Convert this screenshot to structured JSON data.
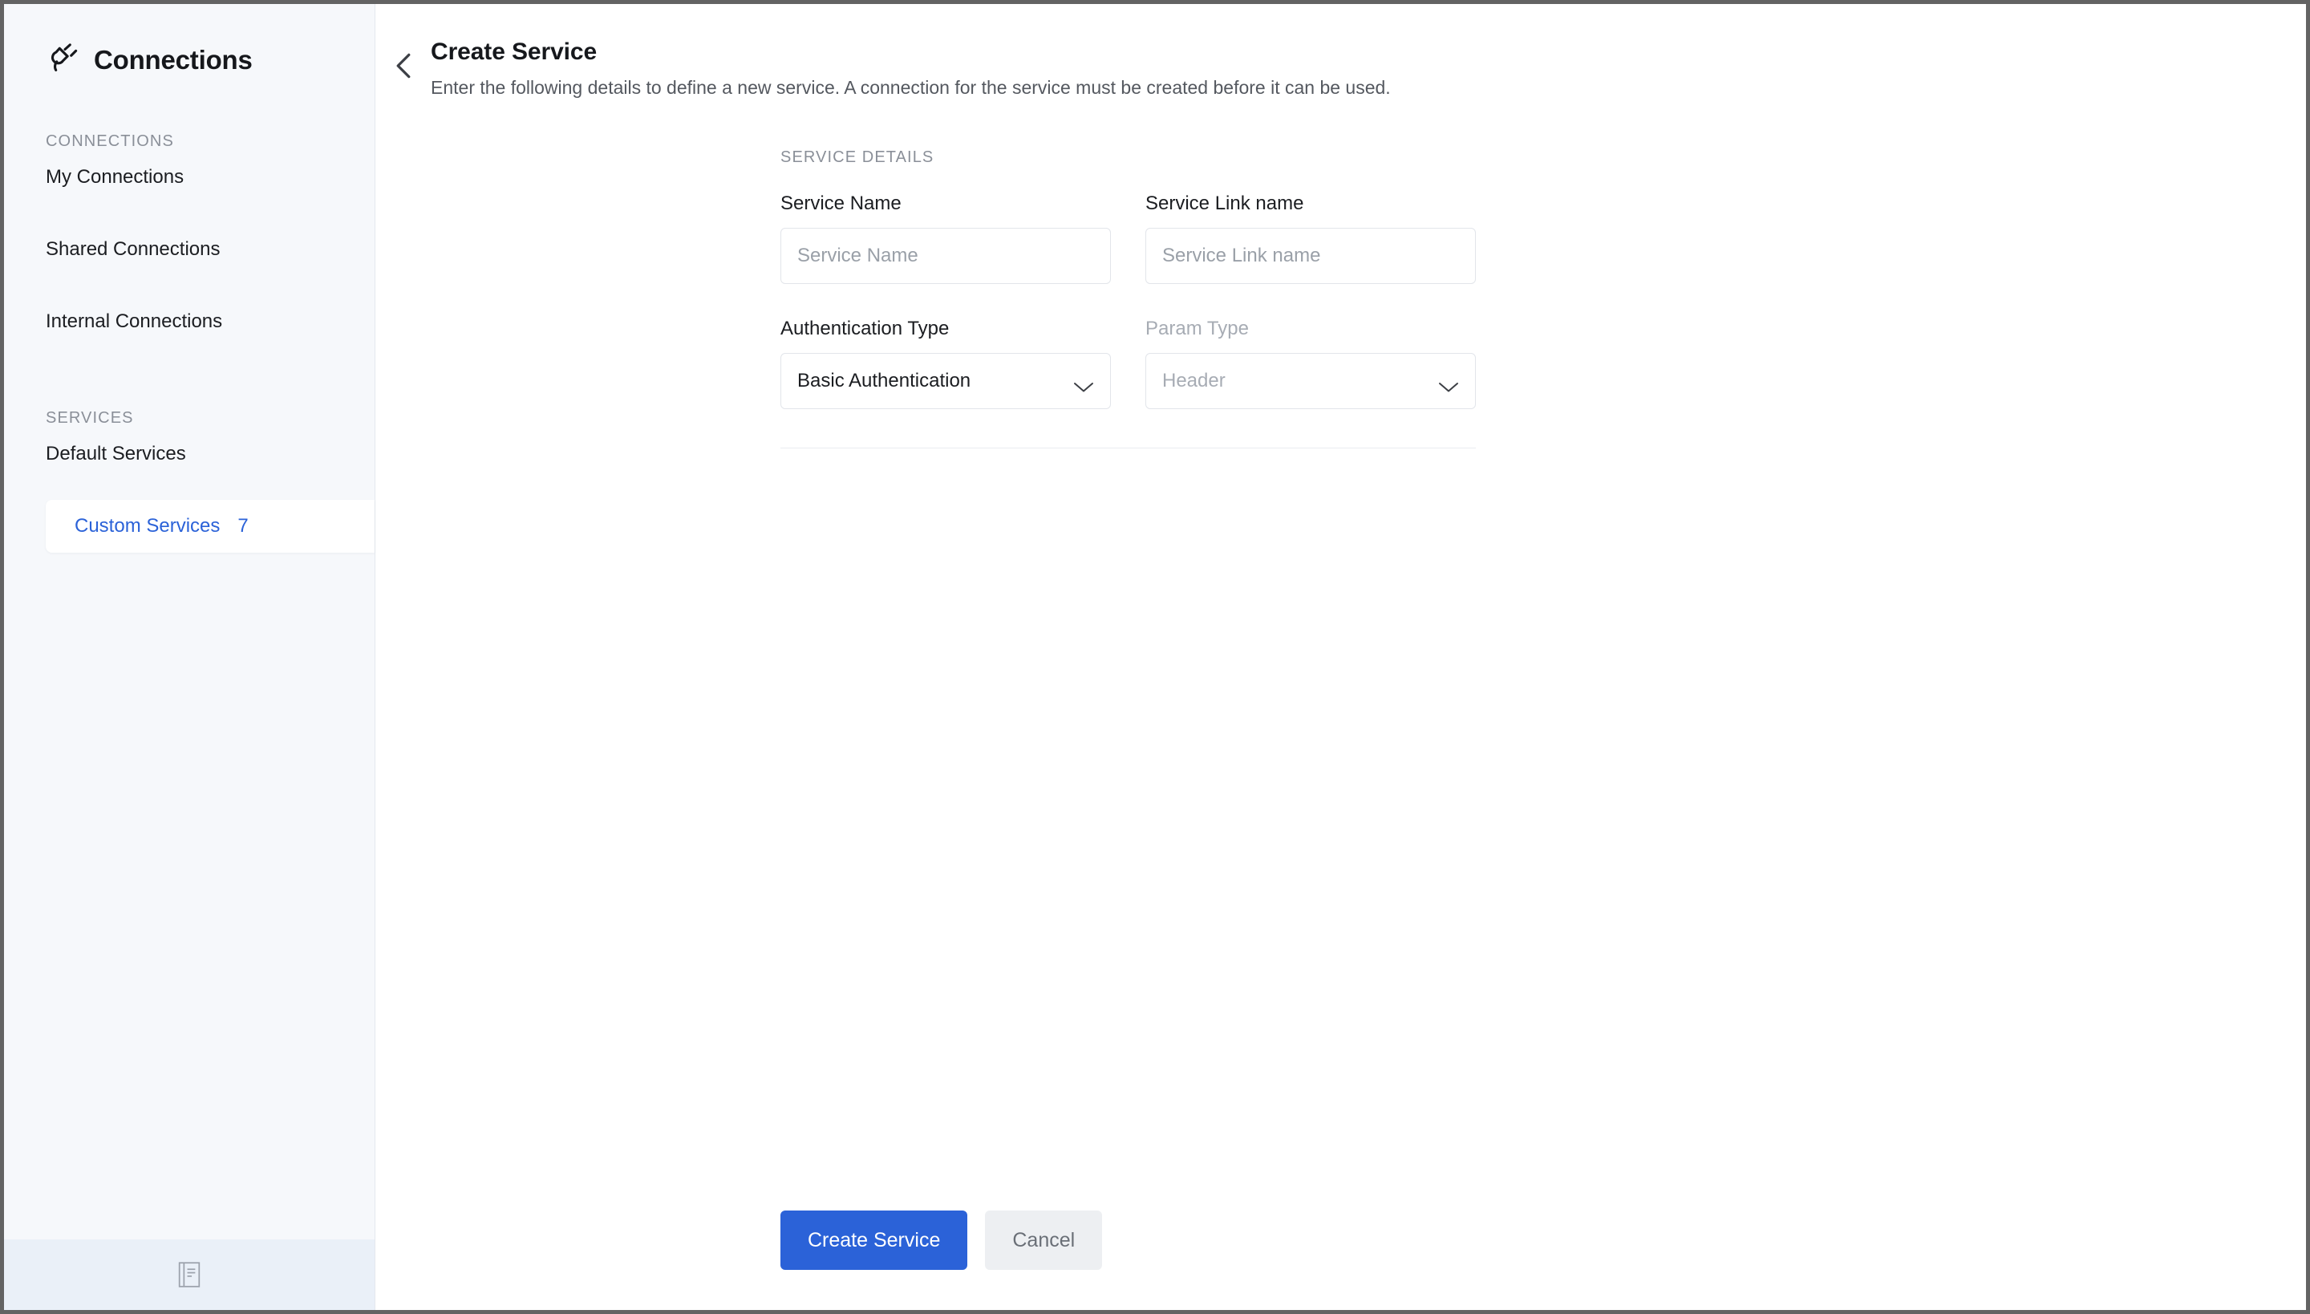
{
  "app": {
    "title": "Connections",
    "logo_icon": "plug-icon"
  },
  "sidebar": {
    "sections": [
      {
        "label": "CONNECTIONS",
        "items": [
          {
            "label": "My Connections",
            "active": false
          },
          {
            "label": "Shared Connections",
            "active": false
          },
          {
            "label": "Internal Connections",
            "active": false
          }
        ]
      },
      {
        "label": "SERVICES",
        "items": [
          {
            "label": "Default Services",
            "active": false
          },
          {
            "label": "Custom Services",
            "count": "7",
            "active": true
          }
        ]
      }
    ],
    "footer": {
      "icon": "book-icon"
    }
  },
  "page": {
    "back_icon": "chevron-left-icon",
    "title": "Create Service",
    "subtitle": "Enter the following details to define a new service. A connection for the service must be created before it can be used.",
    "section_label": "SERVICE DETAILS"
  },
  "form": {
    "service_name": {
      "label": "Service Name",
      "placeholder": "Service Name",
      "value": ""
    },
    "service_link_name": {
      "label": "Service Link name",
      "placeholder": "Service Link name",
      "value": ""
    },
    "authentication_type": {
      "label": "Authentication Type",
      "value": "Basic Authentication",
      "icon": "chevron-down-icon"
    },
    "param_type": {
      "label": "Param Type",
      "value": "Header",
      "disabled": true,
      "icon": "chevron-down-icon"
    }
  },
  "actions": {
    "submit_label": "Create Service",
    "cancel_label": "Cancel"
  },
  "colors": {
    "accent": "#2b62d8",
    "sidebar_bg": "#f6f8fb",
    "footer_bg": "#eaf0f8",
    "border": "#e2e5ea",
    "muted_text": "#8a8f98",
    "disabled_text": "#a7acb4"
  }
}
